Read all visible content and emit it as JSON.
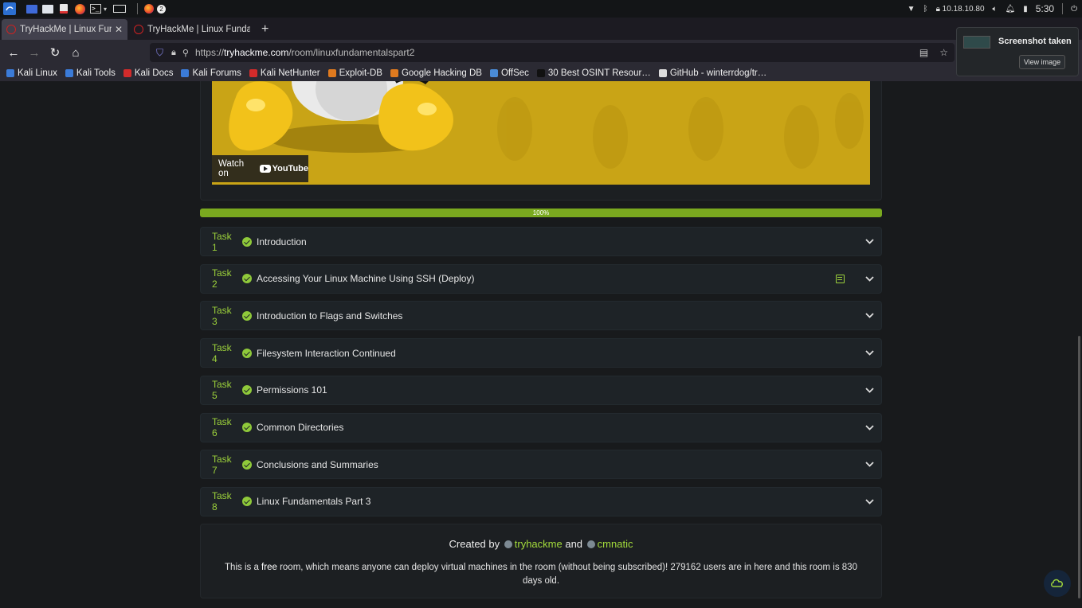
{
  "system_panel": {
    "network_ip": "10.18.10.80",
    "time": "5:30",
    "taskbar_badge": "2"
  },
  "tabs": [
    {
      "title": "TryHackMe | Linux Fundam",
      "active": true
    },
    {
      "title": "TryHackMe | Linux Fundam",
      "active": false
    }
  ],
  "url": {
    "prefix": "https://",
    "domain": "tryhackme.com",
    "path": "/room/linuxfundamentalspart2"
  },
  "bookmarks": [
    {
      "label": "Kali Linux",
      "color": "#3b7bd8"
    },
    {
      "label": "Kali Tools",
      "color": "#3b7bd8"
    },
    {
      "label": "Kali Docs",
      "color": "#d22b2b"
    },
    {
      "label": "Kali Forums",
      "color": "#3b7bd8"
    },
    {
      "label": "Kali NetHunter",
      "color": "#d22b2b"
    },
    {
      "label": "Exploit-DB",
      "color": "#e07a1f"
    },
    {
      "label": "Google Hacking DB",
      "color": "#e07a1f"
    },
    {
      "label": "OffSec",
      "color": "#4a8bd6"
    },
    {
      "label": "30 Best OSINT Resour…",
      "color": "#111111"
    },
    {
      "label": "GitHub - winterrdog/tr…",
      "color": "#dddddd"
    }
  ],
  "notification": {
    "title": "Screenshot taken",
    "button": "View image"
  },
  "video": {
    "watch_label": "Watch on",
    "youtube_label": "YouTube"
  },
  "progress": {
    "value": 100,
    "label": "100%",
    "color": "#7aa91f"
  },
  "tasks": [
    {
      "num": "Task 1",
      "name": "Introduction",
      "has_notes": false
    },
    {
      "num": "Task 2",
      "name": "Accessing Your Linux Machine Using SSH (Deploy)",
      "has_notes": true
    },
    {
      "num": "Task 3",
      "name": "Introduction to Flags and Switches",
      "has_notes": false
    },
    {
      "num": "Task 4",
      "name": "Filesystem Interaction Continued",
      "has_notes": false
    },
    {
      "num": "Task 5",
      "name": "Permissions 101",
      "has_notes": false
    },
    {
      "num": "Task 6",
      "name": "Common Directories",
      "has_notes": false
    },
    {
      "num": "Task 7",
      "name": "Conclusions and Summaries",
      "has_notes": false
    },
    {
      "num": "Task 8",
      "name": "Linux Fundamentals Part 3",
      "has_notes": false
    }
  ],
  "footer": {
    "created_by": "Created by",
    "author1": "tryhackme",
    "and": "and",
    "author2": "cmnatic",
    "desc_pre": "This is a ",
    "desc_free": "free",
    "desc_post": " room, which means anyone can deploy virtual machines in the room (without being subscribed)! 279162 users are in here and this room is 830 days old."
  },
  "colors": {
    "accent_green": "#9cd13b",
    "check_green": "#8fc93a",
    "card_bg": "#1e2327",
    "page_bg": "#181a1c"
  }
}
